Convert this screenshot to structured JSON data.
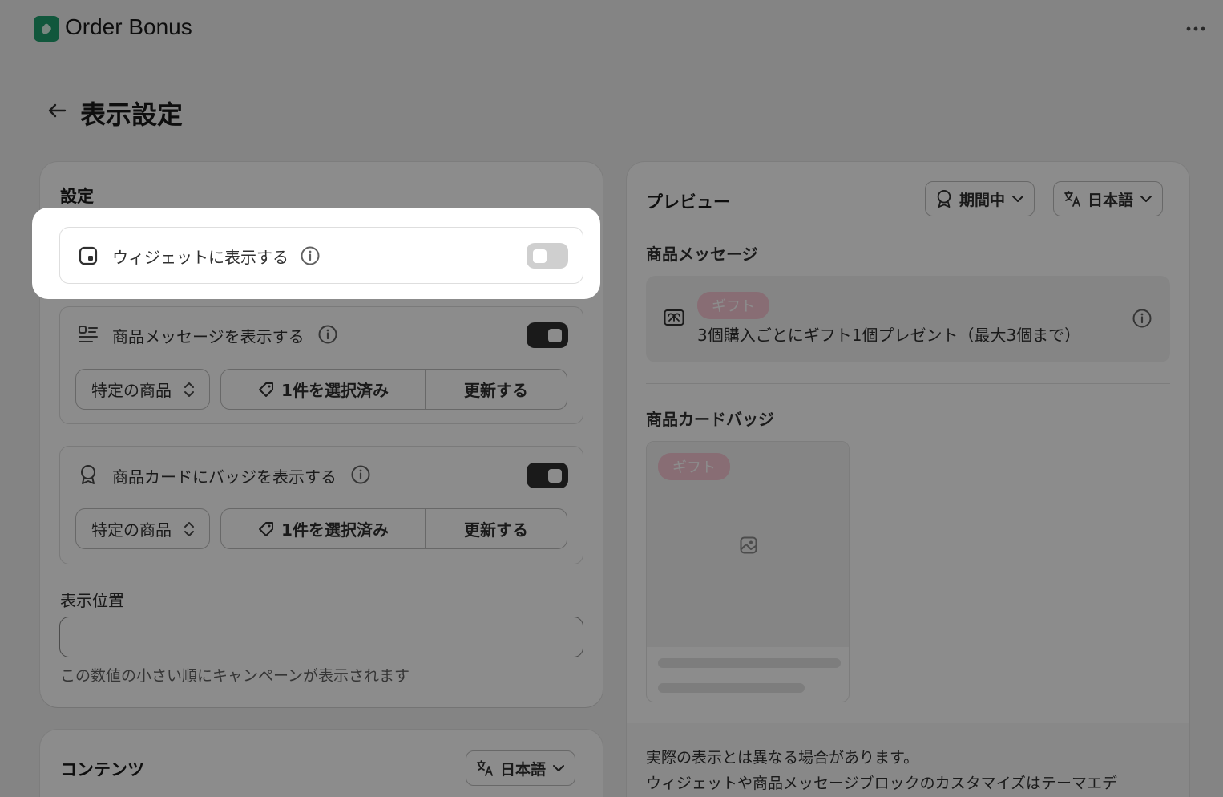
{
  "app": {
    "name": "Order Bonus"
  },
  "page": {
    "title": "表示設定"
  },
  "settings": {
    "heading": "設定",
    "widget": {
      "label": "ウィジェットに表示する",
      "enabled": false
    },
    "product_message": {
      "label": "商品メッセージを表示する",
      "enabled": true,
      "target_select": "特定の商品",
      "selected_label": "1件を選択済み",
      "update_label": "更新する"
    },
    "product_badge": {
      "label": "商品カードにバッジを表示する",
      "enabled": true,
      "target_select": "特定の商品",
      "selected_label": "1件を選択済み",
      "update_label": "更新する"
    },
    "position": {
      "label": "表示位置",
      "value": "",
      "help": "この数値の小さい順にキャンペーンが表示されます"
    }
  },
  "content": {
    "heading": "コンテンツ",
    "language": "日本語"
  },
  "preview": {
    "heading": "プレビュー",
    "period_select": "期間中",
    "language_select": "日本語",
    "product_message_heading": "商品メッセージ",
    "badge_text": "ギフト",
    "message_text": "3個購入ごとにギフト1個プレゼント（最大3個まで）",
    "product_card_badge_heading": "商品カードバッジ",
    "card_badge_text": "ギフト",
    "notice_line1": "実際の表示とは異なる場合があります。",
    "notice_line2": "ウィジェットや商品メッセージブロックのカスタマイズはテーマエデ"
  },
  "colors": {
    "accent": "#1f9e6e",
    "badge": "#f7c6d4",
    "toggle_on": "#303030",
    "toggle_off": "#cfcfcf"
  },
  "icons": {
    "app_logo": "order-bonus-logo-icon",
    "more": "more-horizontal-icon",
    "back": "arrow-left-icon",
    "widget": "widget-icon",
    "product_message": "text-list-icon",
    "badge": "badge-icon",
    "info": "info-icon",
    "tag": "tag-icon",
    "language": "language-icon",
    "gift": "gift-card-icon",
    "image": "image-placeholder-icon"
  }
}
